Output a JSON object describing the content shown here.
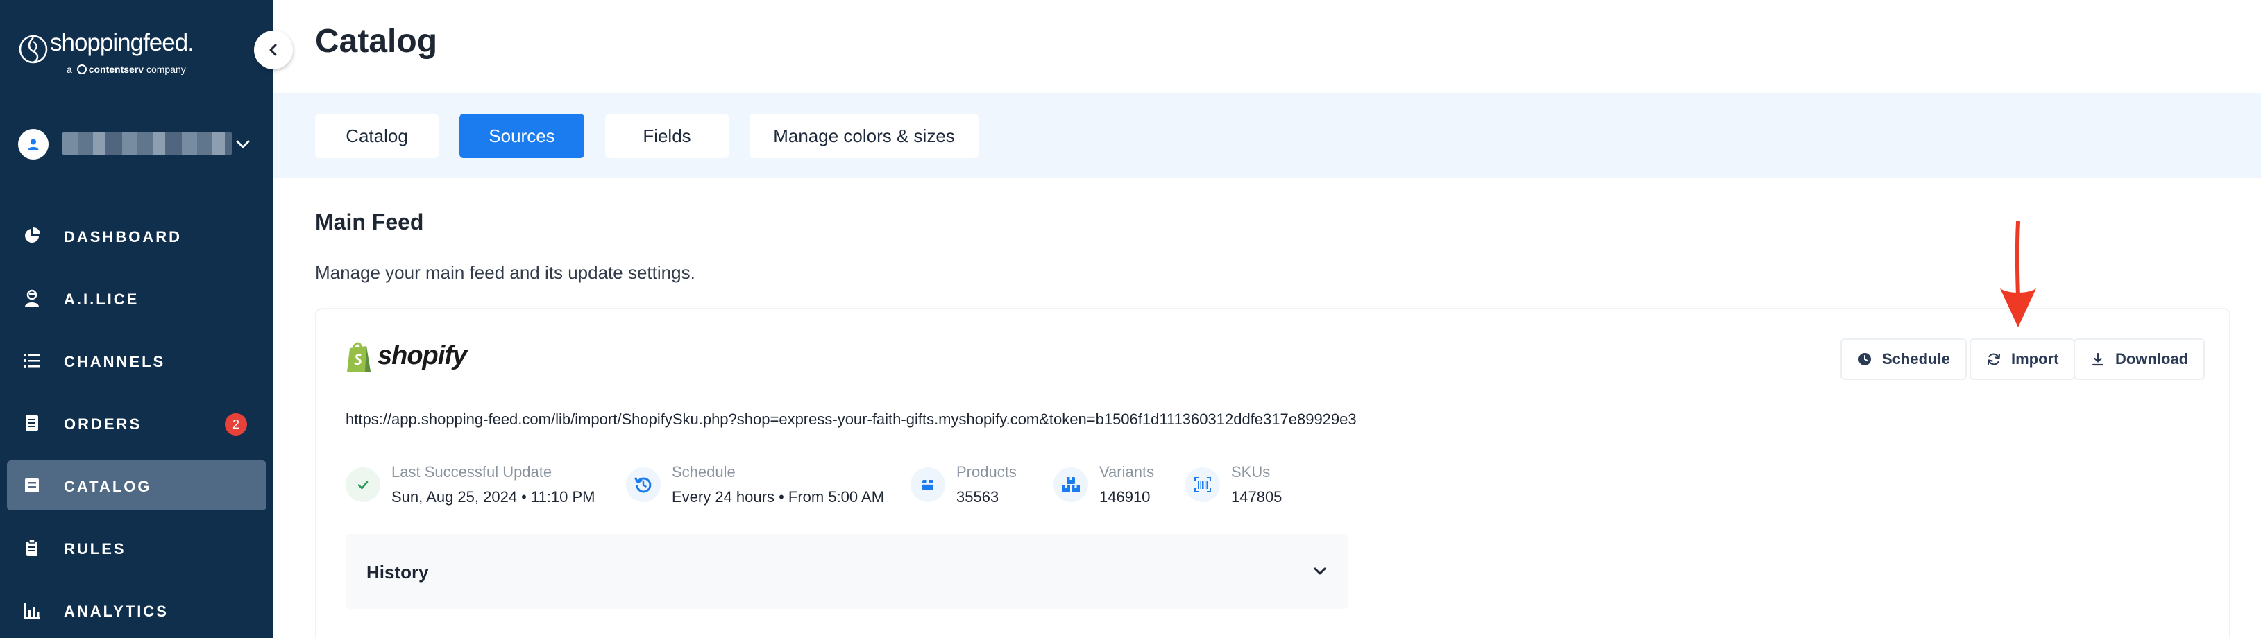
{
  "brand": {
    "name": "shoppingfeed.",
    "tagline_prefix": "a",
    "tagline_company": "contentserv",
    "tagline_suffix": "company"
  },
  "account": {
    "name": "████████████"
  },
  "nav": {
    "items": [
      {
        "label": "DASHBOARD",
        "icon": "pie-chart-icon"
      },
      {
        "label": "A.I.LICE",
        "icon": "assistant-icon"
      },
      {
        "label": "CHANNELS",
        "icon": "list-icon"
      },
      {
        "label": "ORDERS",
        "icon": "receipt-icon",
        "badge": "2"
      },
      {
        "label": "CATALOG",
        "icon": "catalog-icon",
        "active": true
      },
      {
        "label": "RULES",
        "icon": "clipboard-icon"
      },
      {
        "label": "ANALYTICS",
        "icon": "bar-chart-icon"
      }
    ]
  },
  "page": {
    "title": "Catalog"
  },
  "tabs": [
    {
      "label": "Catalog"
    },
    {
      "label": "Sources",
      "active": true
    },
    {
      "label": "Fields"
    },
    {
      "label": "Manage colors & sizes"
    }
  ],
  "section": {
    "title": "Main Feed",
    "description": "Manage your main feed and its update settings."
  },
  "feed": {
    "source_name": "shopify",
    "url": "https://app.shopping-feed.com/lib/import/ShopifySku.php?shop=express-your-faith-gifts.myshopify.com&token=b1506f1d111360312ddfe317e89929e3",
    "actions": {
      "schedule": "Schedule",
      "import": "Import",
      "download": "Download"
    },
    "stats": [
      {
        "label": "Last Successful Update",
        "value": "Sun, Aug 25, 2024 • 11:10 PM",
        "icon": "check-icon"
      },
      {
        "label": "Schedule",
        "value": "Every 24 hours • From 5:00 AM",
        "icon": "history-clock-icon"
      },
      {
        "label": "Products",
        "value": "35563",
        "icon": "box-icon"
      },
      {
        "label": "Variants",
        "value": "146910",
        "icon": "boxes-icon"
      },
      {
        "label": "SKUs",
        "value": "147805",
        "icon": "barcode-icon"
      }
    ],
    "history_label": "History"
  },
  "colors": {
    "sidebar": "#102f4d",
    "accent": "#1b7cf0",
    "badge": "#e8413a",
    "arrow": "#ee3a24"
  }
}
